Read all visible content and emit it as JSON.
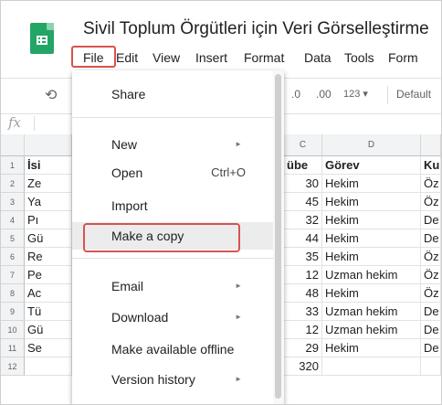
{
  "document": {
    "title": "Sivil Toplum Örgütleri için Veri Görselleştirme"
  },
  "menubar": {
    "file": "File",
    "edit": "Edit",
    "view": "View",
    "insert": "Insert",
    "format": "Format",
    "data": "Data",
    "tools": "Tools",
    "form": "Form"
  },
  "toolbar": {
    "decrease_decimal": ".0",
    "increase_decimal": ".00",
    "number_format": "123 ▾",
    "font": "Default"
  },
  "formula_bar": {
    "fx": "fx"
  },
  "columns": {
    "c": "C",
    "d": "D"
  },
  "rows": [
    "1",
    "2",
    "3",
    "4",
    "5",
    "6",
    "7",
    "8",
    "9",
    "10",
    "11",
    "12"
  ],
  "col_a": [
    "İsi",
    "Ze",
    "Ya",
    "Pı",
    "Gü",
    "Re",
    "Pe",
    "Ac",
    "Tü",
    "Gü",
    "Se",
    ""
  ],
  "col_c": [
    "übe",
    "30",
    "45",
    "32",
    "44",
    "35",
    "12",
    "48",
    "33",
    "12",
    "29",
    "320"
  ],
  "col_d": [
    "Görev",
    "Hekim",
    "Hekim",
    "Hekim",
    "Hekim",
    "Hekim",
    "Uzman hekim",
    "Hekim",
    "Uzman hekim",
    "Uzman hekim",
    "Hekim",
    ""
  ],
  "col_e": [
    "Ku",
    "Öz",
    "Öz",
    "De",
    "De",
    "Öz",
    "Öz",
    "Öz",
    "De",
    "De",
    "De",
    ""
  ],
  "file_menu": {
    "share": "Share",
    "new": "New",
    "open": "Open",
    "open_shortcut": "Ctrl+O",
    "import": "Import",
    "make_copy": "Make a copy",
    "email": "Email",
    "download": "Download",
    "offline": "Make available offline",
    "version_history": "Version history",
    "submenu_arrow": "►"
  },
  "colors": {
    "highlight": "#d9534f",
    "sheets_green": "#23a566"
  }
}
